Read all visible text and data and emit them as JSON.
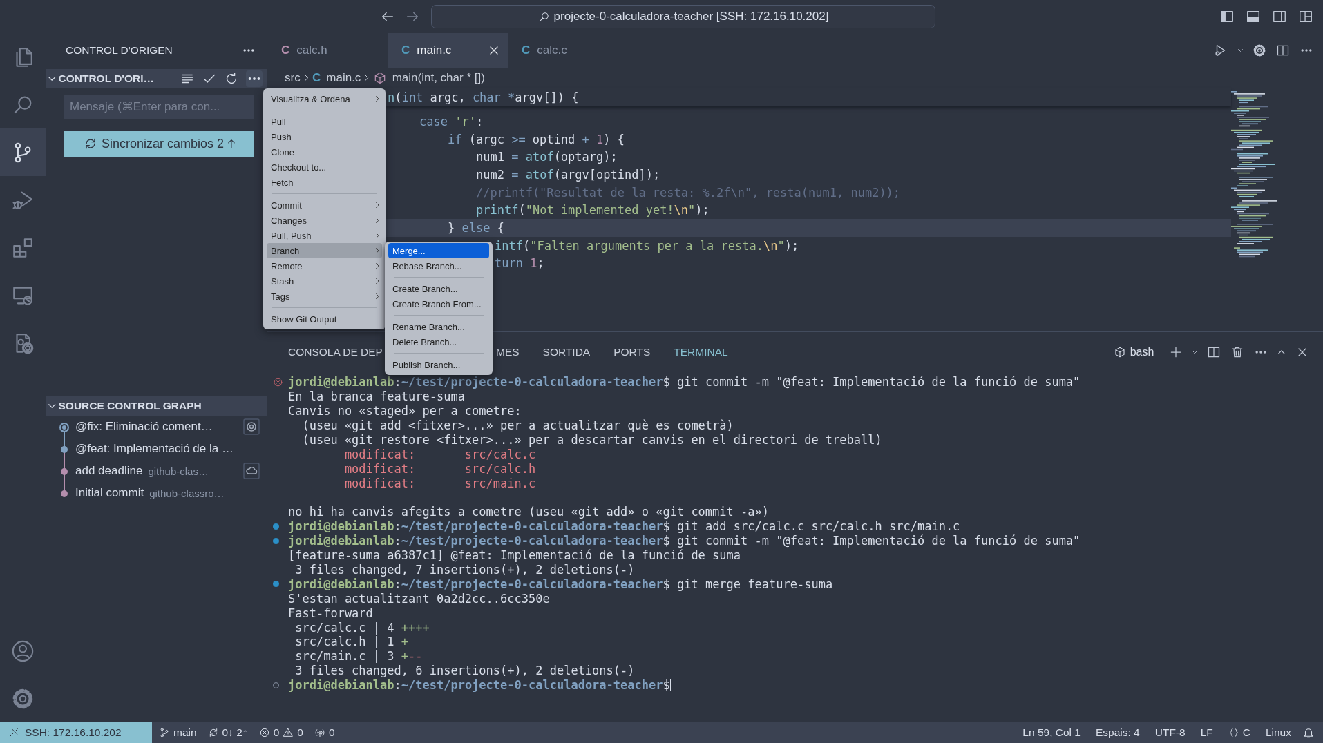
{
  "window": {
    "title": "projecte-0-calculadora-teacher [SSH: 172.16.10.202]"
  },
  "activity_bar": [
    {
      "kind": "files",
      "selected": false
    },
    {
      "kind": "search",
      "selected": false
    },
    {
      "kind": "source-control",
      "selected": true
    },
    {
      "kind": "run-debug",
      "selected": false
    },
    {
      "kind": "extensions",
      "selected": false
    },
    {
      "kind": "remote",
      "selected": false
    },
    {
      "kind": "testing",
      "selected": false
    },
    {
      "kind": "account",
      "selected": false
    },
    {
      "kind": "settings",
      "selected": false
    }
  ],
  "sidebar": {
    "title": "CONTROL D'ORIGEN",
    "section": {
      "title": "CONTROL D'ORI…",
      "expanded": true
    },
    "message": {
      "placeholder": "Mensaje (⌘Enter para con..."
    },
    "sync_button": {
      "label": "Sincronizar cambios 2"
    },
    "graph": {
      "title": "SOURCE CONTROL GRAPH",
      "expanded": true,
      "commits": [
        {
          "message": "@fix: Eliminació coment…",
          "current": true,
          "color": "#81a1c1",
          "badge": {
            "kind": "target"
          }
        },
        {
          "message": "@feat: Implementació de la …",
          "current": false,
          "color": "#81a1c1"
        },
        {
          "message": "add deadline",
          "author": "github-clas…",
          "current": false,
          "color": "#b48ead",
          "badge": {
            "kind": "cloud"
          }
        },
        {
          "message": "Initial commit",
          "author": "github-classro…",
          "current": false,
          "color": "#b48ead"
        }
      ]
    }
  },
  "tabs": [
    {
      "icon": "C",
      "label": "calc.h",
      "color": "#b48ead",
      "selected": false
    },
    {
      "icon": "C",
      "label": "main.c",
      "color": "#519aba",
      "selected": true
    },
    {
      "icon": "C",
      "label": "calc.c",
      "color": "#519aba",
      "selected": false
    }
  ],
  "breadcrumb": [
    {
      "kind": "folder",
      "label": "src"
    },
    {
      "kind": "file",
      "icon": "C",
      "label": "main.c",
      "color": "#519aba"
    },
    {
      "kind": "symbol",
      "label": "main(int, char * [])"
    }
  ],
  "sticky_line": {
    "cut": true,
    "segments": [
      {
        "kind": "fn",
        "text": "n"
      },
      {
        "kind": "plain",
        "text": "("
      },
      {
        "kind": "kw",
        "text": "int"
      },
      {
        "kind": "plain",
        "text": " argc, "
      },
      {
        "kind": "kw",
        "text": "char"
      },
      {
        "kind": "kw",
        "text": " *"
      },
      {
        "kind": "plain",
        "text": "argv[]) {"
      }
    ]
  },
  "code": [
    {
      "current": false,
      "segments": [
        {
          "kind": "kw",
          "text": "case"
        },
        {
          "kind": "str",
          "text": " 'r'"
        },
        {
          "kind": "plain",
          "text": ":"
        }
      ],
      "children": [
        {
          "current": false,
          "segments": [
            {
              "kind": "kw",
              "text": "if"
            },
            {
              "kind": "plain",
              "text": " (argc "
            },
            {
              "kind": "kw",
              "text": ">="
            },
            {
              "kind": "plain",
              "text": " optind "
            },
            {
              "kind": "kw",
              "text": "+"
            },
            {
              "kind": "num",
              "text": " 1"
            },
            {
              "kind": "plain",
              "text": ") {"
            }
          ],
          "children": [
            {
              "current": false,
              "segments": [
                {
                  "kind": "plain",
                  "text": "num1 "
                },
                {
                  "kind": "kw",
                  "text": "="
                },
                {
                  "kind": "fn",
                  "text": " atof"
                },
                {
                  "kind": "plain",
                  "text": "(optarg);"
                }
              ]
            },
            {
              "current": false,
              "segments": [
                {
                  "kind": "plain",
                  "text": "num2 "
                },
                {
                  "kind": "kw",
                  "text": "="
                },
                {
                  "kind": "fn",
                  "text": " atof"
                },
                {
                  "kind": "plain",
                  "text": "(argv[optind]);"
                }
              ]
            },
            {
              "current": false,
              "segments": [
                {
                  "kind": "comment",
                  "text": "//printf(\"Resultat de la resta: %.2f\\n\", resta(num1, num2));"
                }
              ]
            },
            {
              "current": false,
              "segments": [
                {
                  "kind": "fn",
                  "text": "printf"
                },
                {
                  "kind": "plain",
                  "text": "("
                },
                {
                  "kind": "str",
                  "text": "\"Not implemented yet!"
                },
                {
                  "kind": "esc",
                  "text": "\\n"
                },
                {
                  "kind": "str",
                  "text": "\""
                },
                {
                  "kind": "plain",
                  "text": ");"
                }
              ]
            }
          ]
        },
        {
          "current": true,
          "segments": [
            {
              "kind": "plain",
              "text": "} "
            },
            {
              "kind": "kw",
              "text": "else"
            },
            {
              "kind": "plain",
              "text": " {"
            }
          ],
          "children": [
            {
              "current": false,
              "cut": true,
              "segments": [
                {
                  "kind": "fn",
                  "text": "intf"
                },
                {
                  "kind": "plain",
                  "text": "("
                },
                {
                  "kind": "str",
                  "text": "\"Falten arguments per a la resta."
                },
                {
                  "kind": "esc",
                  "text": "\\n"
                },
                {
                  "kind": "str",
                  "text": "\""
                },
                {
                  "kind": "plain",
                  "text": ");"
                }
              ]
            },
            {
              "current": false,
              "cut": true,
              "segments": [
                {
                  "kind": "kw",
                  "text": "turn"
                },
                {
                  "kind": "num",
                  "text": " 1"
                },
                {
                  "kind": "plain",
                  "text": ";"
                }
              ]
            }
          ]
        }
      ]
    }
  ],
  "panel": {
    "tabs": [
      {
        "label": "CONSOLA DE DEP",
        "selected": false
      },
      {
        "label": "MES",
        "selected": false
      },
      {
        "label": "SORTIDA",
        "selected": false
      },
      {
        "label": "PORTS",
        "selected": false
      },
      {
        "label": "TERMINAL",
        "selected": true
      }
    ],
    "terminal_name": "bash",
    "terminal": [
      {
        "kind": "failed",
        "user": "jordi@debianlab",
        "sep": ":",
        "path": "~/test/projecte-0-calculadora-teacher",
        "command": "$ git commit -m \"@feat: Implementació de la funció de suma\""
      },
      {
        "kind": "output",
        "segments": [
          {
            "kind": "plain",
            "text": "En la branca feature-suma"
          }
        ]
      },
      {
        "kind": "output",
        "segments": [
          {
            "kind": "plain",
            "text": "Canvis no «staged» per a cometre:"
          }
        ]
      },
      {
        "kind": "output",
        "segments": [
          {
            "kind": "plain",
            "text": "  (useu «git add <fitxer>...» per a actualitzar què es cometrà)"
          }
        ]
      },
      {
        "kind": "output",
        "segments": [
          {
            "kind": "plain",
            "text": "  (useu «git restore <fitxer>...» per a descartar canvis en el directori de treball)"
          }
        ]
      },
      {
        "kind": "output",
        "segments": [
          {
            "kind": "removed",
            "text": "        modificat:       src/calc.c"
          }
        ]
      },
      {
        "kind": "output",
        "segments": [
          {
            "kind": "removed",
            "text": "        modificat:       src/calc.h"
          }
        ]
      },
      {
        "kind": "output",
        "segments": [
          {
            "kind": "removed",
            "text": "        modificat:       src/main.c"
          }
        ]
      },
      {
        "kind": "output",
        "blank_before": true,
        "segments": [
          {
            "kind": "plain",
            "text": "no hi ha canvis afegits a cometre (useu «git add» o «git commit -a»)"
          }
        ]
      },
      {
        "kind": "succeeded",
        "user": "jordi@debianlab",
        "sep": ":",
        "path": "~/test/projecte-0-calculadora-teacher",
        "command": "$ git add src/calc.c src/calc.h src/main.c"
      },
      {
        "kind": "succeeded",
        "user": "jordi@debianlab",
        "sep": ":",
        "path": "~/test/projecte-0-calculadora-teacher",
        "command": "$ git commit -m \"@feat: Implementació de la funció de suma\""
      },
      {
        "kind": "output",
        "segments": [
          {
            "kind": "plain",
            "text": "[feature-suma a6387c1] @feat: Implementació de la funció de suma"
          }
        ]
      },
      {
        "kind": "output",
        "segments": [
          {
            "kind": "plain",
            "text": " 3 files changed, 7 insertions(+), 2 deletions(-)"
          }
        ]
      },
      {
        "kind": "succeeded",
        "user": "jordi@debianlab",
        "sep": ":",
        "path": "~/test/projecte-0-calculadora-teacher",
        "command": "$ git merge feature-suma"
      },
      {
        "kind": "output",
        "segments": [
          {
            "kind": "plain",
            "text": "S'estan actualitzant 0a2d2cc..6cc350e"
          }
        ]
      },
      {
        "kind": "output",
        "segments": [
          {
            "kind": "plain",
            "text": "Fast-forward"
          }
        ]
      },
      {
        "kind": "output",
        "segments": [
          {
            "kind": "plain",
            "text": " src/calc.c | 4 "
          },
          {
            "kind": "added",
            "text": "++++"
          }
        ]
      },
      {
        "kind": "output",
        "segments": [
          {
            "kind": "plain",
            "text": " src/calc.h | 1 "
          },
          {
            "kind": "added",
            "text": "+"
          }
        ]
      },
      {
        "kind": "output",
        "segments": [
          {
            "kind": "plain",
            "text": " src/main.c | 3 "
          },
          {
            "kind": "added",
            "text": "+"
          },
          {
            "kind": "removed",
            "text": "--"
          }
        ]
      },
      {
        "kind": "output",
        "segments": [
          {
            "kind": "plain",
            "text": " 3 files changed, 6 insertions(+), 2 deletions(-)"
          }
        ]
      },
      {
        "kind": "pending",
        "user": "jordi@debianlab",
        "sep": ":",
        "path": "~/test/projecte-0-calculadora-teacher",
        "command": "$",
        "cursor": true
      }
    ]
  },
  "context_menu": {
    "groups": [
      [
        {
          "label": "Visualitza & Ordena",
          "submenu": true,
          "highlighted": false
        }
      ],
      [
        {
          "label": "Pull",
          "submenu": false,
          "highlighted": false
        },
        {
          "label": "Push",
          "submenu": false,
          "highlighted": false
        },
        {
          "label": "Clone",
          "submenu": false,
          "highlighted": false
        },
        {
          "label": "Checkout to...",
          "submenu": false,
          "highlighted": false
        },
        {
          "label": "Fetch",
          "submenu": false,
          "highlighted": false
        }
      ],
      [
        {
          "label": "Commit",
          "submenu": true,
          "highlighted": false
        },
        {
          "label": "Changes",
          "submenu": true,
          "highlighted": false
        },
        {
          "label": "Pull, Push",
          "submenu": true,
          "highlighted": false
        },
        {
          "label": "Branch",
          "submenu": true,
          "highlighted": true
        },
        {
          "label": "Remote",
          "submenu": true,
          "highlighted": false
        },
        {
          "label": "Stash",
          "submenu": true,
          "highlighted": false
        },
        {
          "label": "Tags",
          "submenu": true,
          "highlighted": false
        }
      ],
      [
        {
          "label": "Show Git Output",
          "submenu": false,
          "highlighted": false
        }
      ]
    ]
  },
  "submenu": {
    "groups": [
      [
        {
          "label": "Merge...",
          "highlighted": true
        },
        {
          "label": "Rebase Branch...",
          "highlighted": false
        }
      ],
      [
        {
          "label": "Create Branch...",
          "highlighted": false
        },
        {
          "label": "Create Branch From...",
          "highlighted": false
        }
      ],
      [
        {
          "label": "Rename Branch...",
          "highlighted": false
        },
        {
          "label": "Delete Branch...",
          "highlighted": false
        }
      ],
      [
        {
          "label": "Publish Branch...",
          "highlighted": false
        }
      ]
    ]
  },
  "status_bar": {
    "left": [
      {
        "kind": "remote",
        "label": "SSH: 172.16.10.202"
      },
      {
        "kind": "branch",
        "label": "main"
      },
      {
        "kind": "sync",
        "label": "0↓ 2↑"
      },
      {
        "kind": "problems",
        "errors": "0",
        "warnings": "0"
      },
      {
        "kind": "ports",
        "label": "0"
      }
    ],
    "right": [
      {
        "kind": "text",
        "label": "Ln 59, Col 1"
      },
      {
        "kind": "text",
        "label": "Espais: 4"
      },
      {
        "kind": "text",
        "label": "UTF-8"
      },
      {
        "kind": "text",
        "label": "LF"
      },
      {
        "kind": "language",
        "label": "C"
      },
      {
        "kind": "text",
        "label": "Linux"
      },
      {
        "kind": "bell"
      }
    ]
  }
}
